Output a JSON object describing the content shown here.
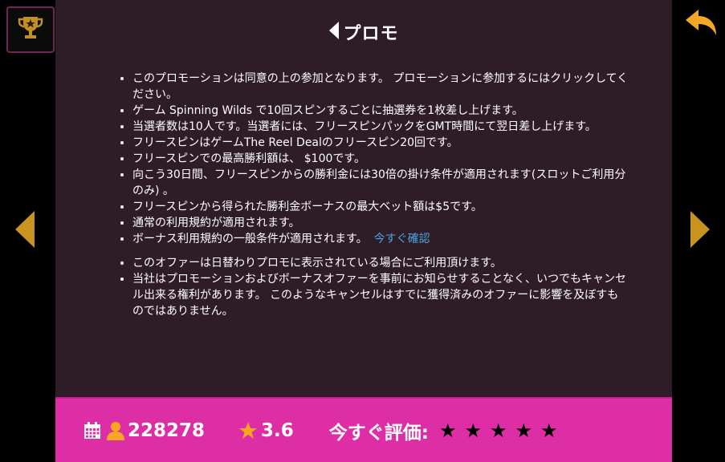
{
  "header": {
    "title": "プロモ"
  },
  "terms": {
    "group1": [
      "このプロモーションは同意の上の参加となります。 プロモーションに参加するにはクリックしてください。",
      "ゲーム Spinning Wilds で10回スピンするごとに抽選券を1枚差し上げます。",
      "当選者数は10人です。当選者には、フリースピンパックをGMT時間にて翌日差し上げます。",
      "フリースピンはゲームThe Reel Dealのフリースピン20回です。",
      "フリースピンでの最高勝利額は、 $100です。",
      "向こう30日間、フリースピンからの勝利金には30倍の掛け条件が適用されます(スロットご利用分のみ) 。",
      "フリースピンから得られた勝利金ボーナスの最大ベット額は$5です。",
      "通常の利用規約が適用されます。"
    ],
    "bonus_terms_text": "ボーナス利用規約の一般条件が適用されます。",
    "bonus_terms_link": "今すぐ確認",
    "group2": [
      "このオファーは日替わりプロモに表示されている場合にご利用頂けます。",
      "当社はプロモーションおよびボーナスオファーを事前にお知らせすることなく、いつでもキャンセル出来る権利があります。 このようなキャンセルはすでに獲得済みのオファーに影響を及ぼすものではありません。"
    ]
  },
  "footer": {
    "players_count": "228278",
    "rating_value": "3.6",
    "rate_label": "今すぐ評価:",
    "rate_stars": [
      "★",
      "★",
      "★",
      "★",
      "★"
    ]
  },
  "icons": {
    "trophy": "trophy-icon",
    "return": "return-arrow-icon",
    "prev": "chevron-left-icon",
    "next": "chevron-right-icon",
    "back": "back-triangle-icon",
    "calendar": "calendar-icon",
    "user": "user-icon",
    "star": "star-icon"
  },
  "colors": {
    "panel_bg": "#2e1d26",
    "footer_bg": "#de2ea6",
    "accent_gold": "#f5a623",
    "nav_gold": "#c8931e",
    "link_blue": "#4ba3e3"
  }
}
